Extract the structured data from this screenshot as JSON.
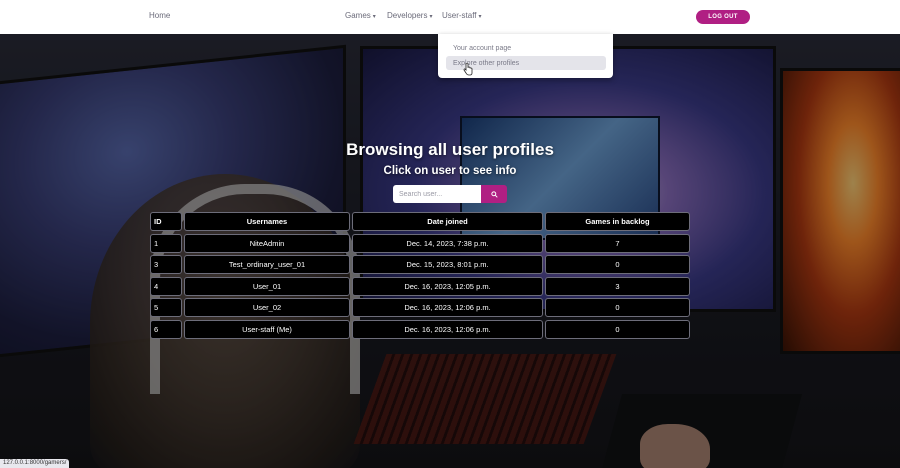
{
  "nav": {
    "home": "Home",
    "games": "Games",
    "developers": "Developers",
    "user_staff": "User-staff",
    "logout": "LOG OUT"
  },
  "dropdown": {
    "items": [
      {
        "label": "Your account page"
      },
      {
        "label": "Explore other profiles"
      }
    ]
  },
  "page": {
    "title": "Browsing all user profiles",
    "subtitle": "Click on user to see info"
  },
  "search": {
    "placeholder": "Search user..."
  },
  "table": {
    "headers": [
      "ID",
      "Usernames",
      "Date joined",
      "Games in backlog"
    ],
    "rows": [
      [
        "1",
        "NiteAdmin",
        "Dec. 14, 2023, 7:38 p.m.",
        "7"
      ],
      [
        "3",
        "Test_ordinary_user_01",
        "Dec. 15, 2023, 8:01 p.m.",
        "0"
      ],
      [
        "4",
        "User_01",
        "Dec. 16, 2023, 12:05 p.m.",
        "3"
      ],
      [
        "5",
        "User_02",
        "Dec. 16, 2023, 12:06 p.m.",
        "0"
      ],
      [
        "6",
        "User-staff (Me)",
        "Dec. 16, 2023, 12:06 p.m.",
        "0"
      ]
    ]
  },
  "status_bar": {
    "url": "127.0.0.1:8000/gamers/"
  },
  "colors": {
    "accent": "#b01f83",
    "cell_bg": "#000000",
    "cell_border": "#6d6d7a"
  },
  "icons": {
    "caret": "chevron-down-icon",
    "search": "search-icon",
    "cursor": "hand-pointer-icon"
  }
}
